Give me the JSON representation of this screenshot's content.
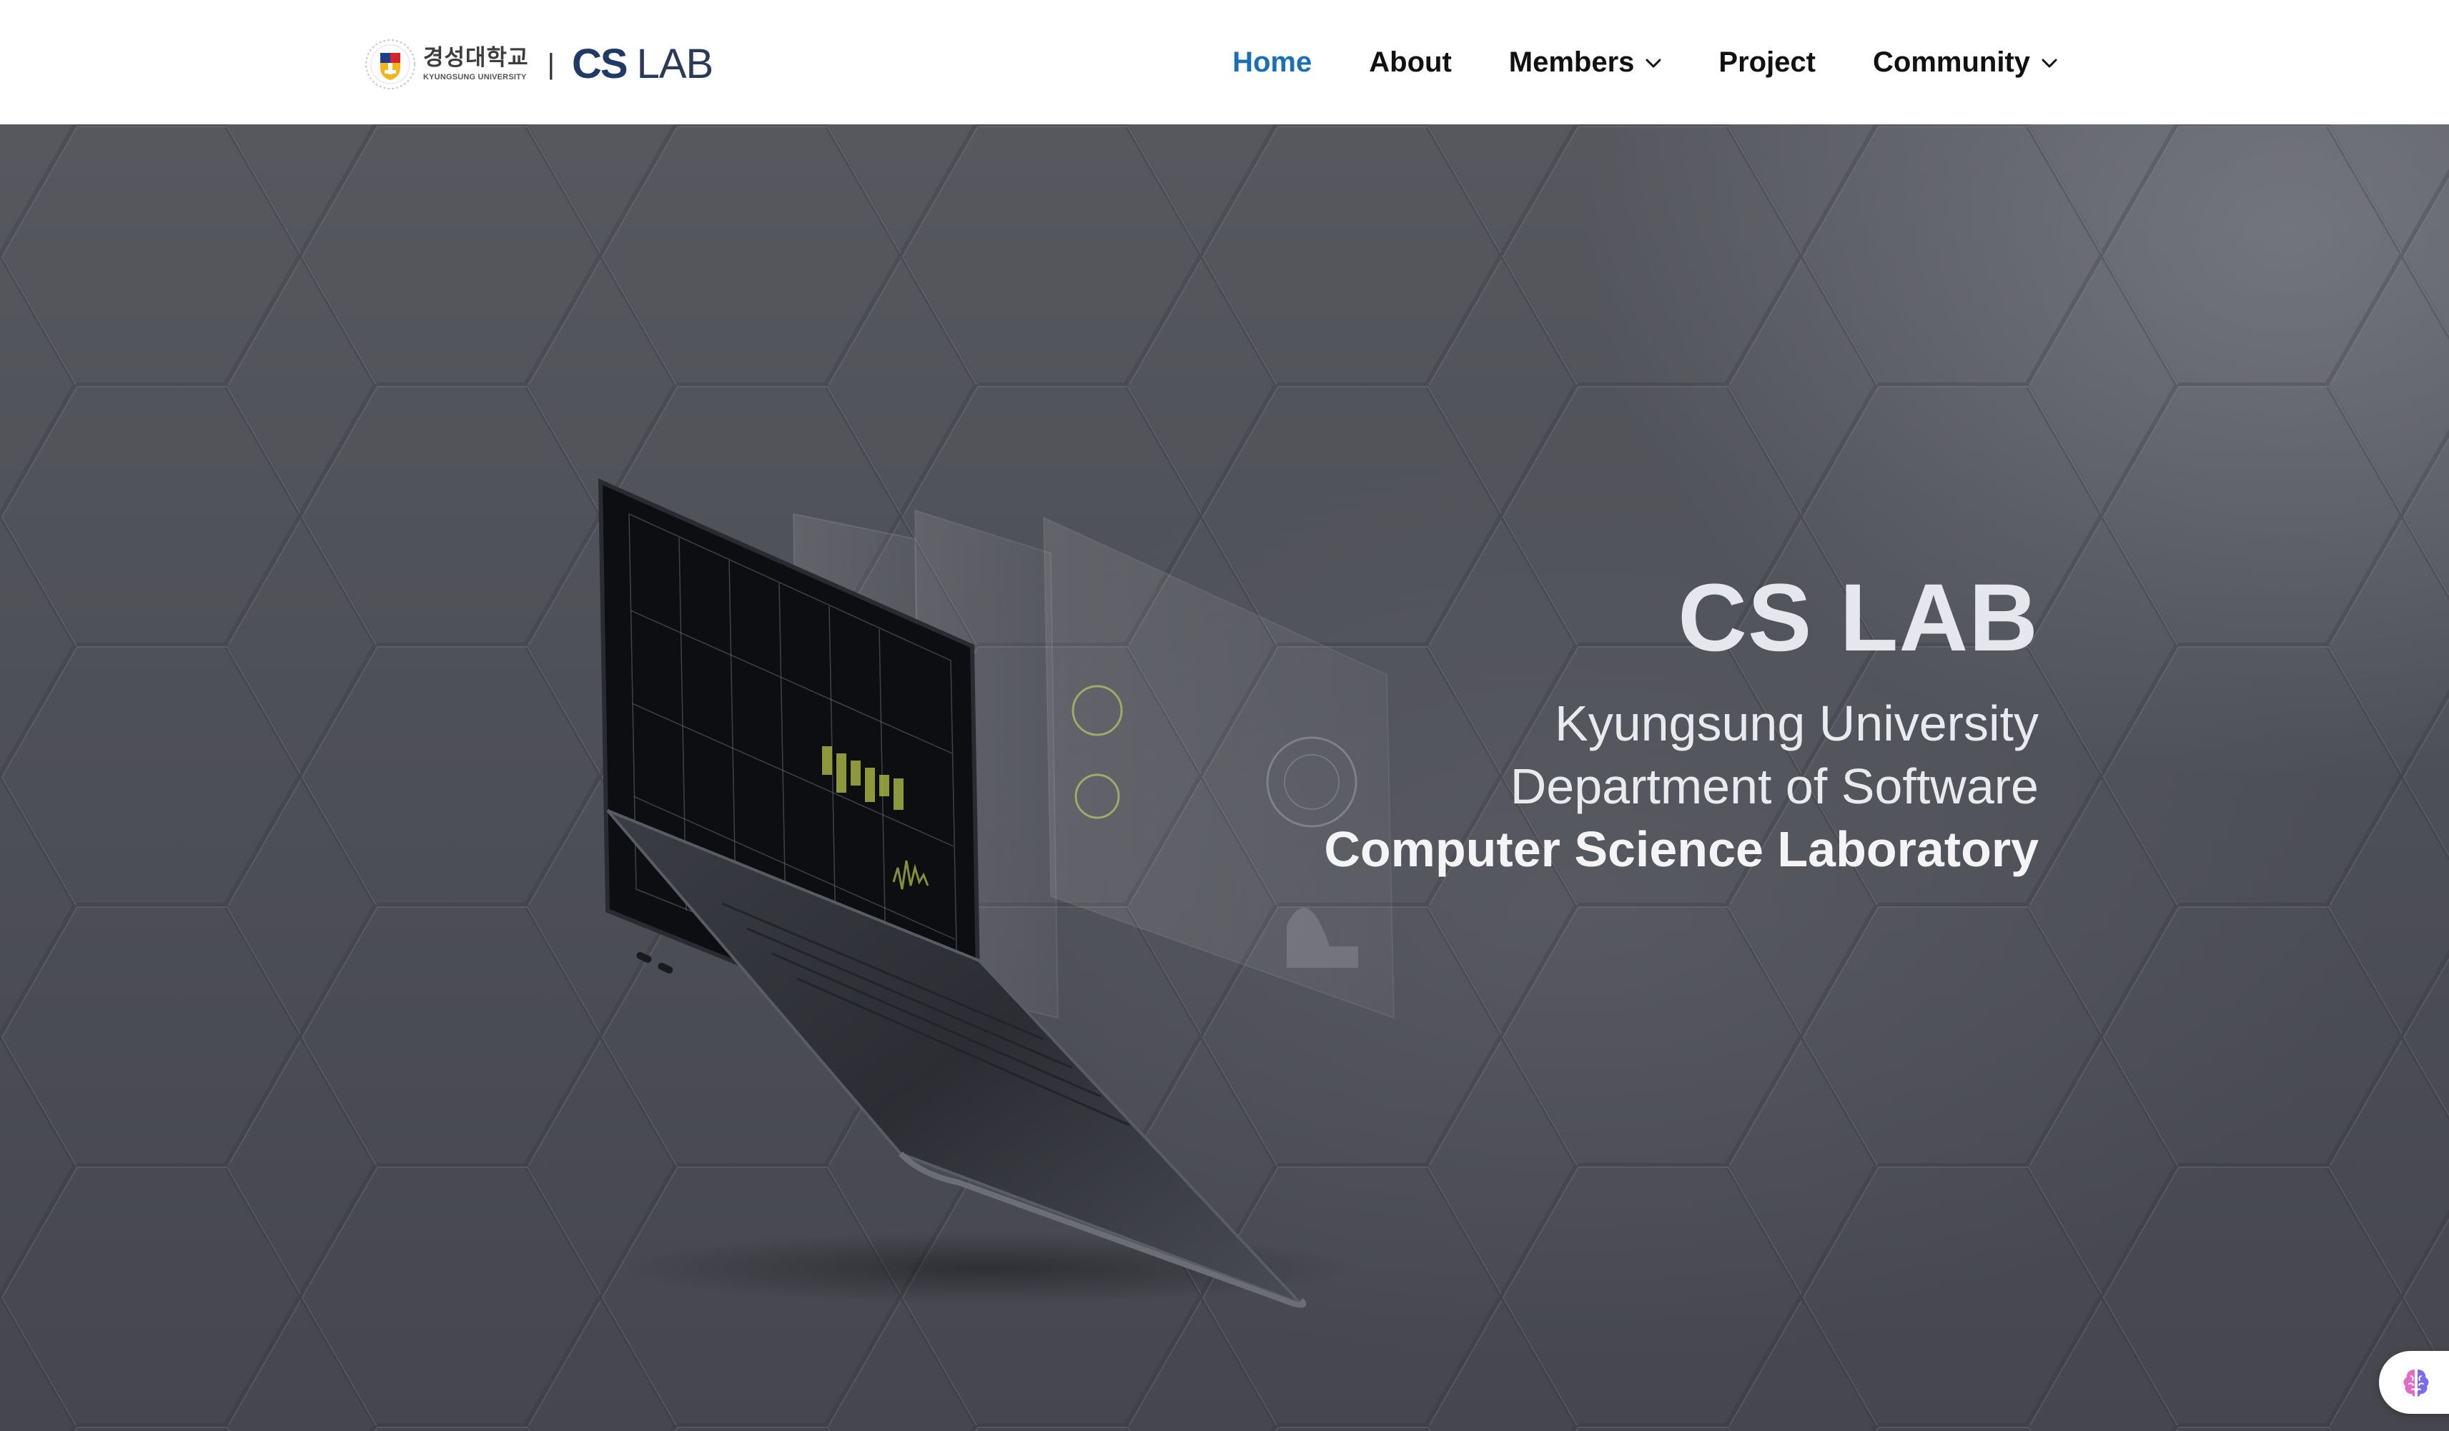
{
  "header": {
    "university": {
      "name_ko": "경성대학교",
      "name_en": "KYUNGSUNG UNIVERSITY"
    },
    "logo_divider": "|",
    "lab_logo": {
      "cs": "CS",
      "lab": "LAB"
    }
  },
  "nav": {
    "items": [
      {
        "label": "Home",
        "active": true,
        "has_dropdown": false
      },
      {
        "label": "About",
        "active": false,
        "has_dropdown": false
      },
      {
        "label": "Members",
        "active": false,
        "has_dropdown": true
      },
      {
        "label": "Project",
        "active": false,
        "has_dropdown": false
      },
      {
        "label": "Community",
        "active": false,
        "has_dropdown": true
      }
    ],
    "active_color": "#1a6fb5",
    "text_color": "#111111"
  },
  "hero": {
    "title": "CS LAB",
    "line1": "Kyungsung University",
    "line2": "Department of Software",
    "line3": "Computer Science Laboratory",
    "image_icon": "floating-laptop-dashboard"
  },
  "widget": {
    "icon": "brain-icon"
  }
}
